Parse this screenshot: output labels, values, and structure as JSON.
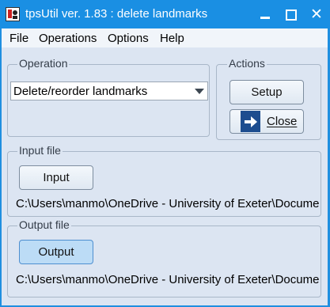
{
  "window": {
    "title": "tpsUtil ver. 1.83  : delete landmarks",
    "accent": "#1a8fe3"
  },
  "menubar": {
    "items": [
      "File",
      "Operations",
      "Options",
      "Help"
    ]
  },
  "operation": {
    "legend": "Operation",
    "selected": "Delete/reorder landmarks"
  },
  "actions": {
    "legend": "Actions",
    "setup_label": "Setup",
    "close_label": "Close"
  },
  "input_file": {
    "legend": "Input file",
    "button_label": "Input",
    "path": "C:\\Users\\manmo\\OneDrive - University of Exeter\\Documents"
  },
  "output_file": {
    "legend": "Output file",
    "button_label": "Output",
    "path": "C:\\Users\\manmo\\OneDrive - University of Exeter\\Documents"
  },
  "icons": [
    "app-icon",
    "minimize-icon",
    "maximize-icon",
    "close-icon",
    "dropdown-arrow-icon",
    "exit-door-icon"
  ]
}
